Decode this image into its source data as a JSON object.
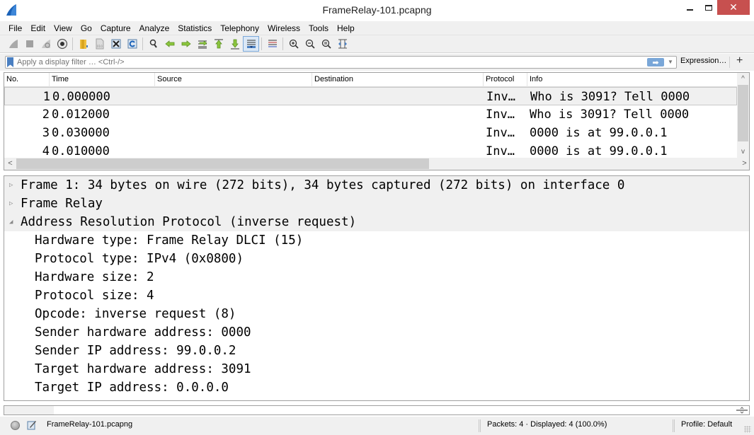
{
  "window": {
    "title": "FrameRelay-101.pcapng",
    "controls": {
      "minimize": "minimize",
      "maximize": "maximize",
      "close": "✕"
    }
  },
  "menu": {
    "items": [
      "File",
      "Edit",
      "View",
      "Go",
      "Capture",
      "Analyze",
      "Statistics",
      "Telephony",
      "Wireless",
      "Tools",
      "Help"
    ]
  },
  "toolbar": {
    "buttons": [
      {
        "icon": "shark-fin-start-icon",
        "label": "Start capturing packets"
      },
      {
        "icon": "stop-icon",
        "label": "Stop capturing packets"
      },
      {
        "icon": "restart-icon",
        "label": "Restart current capture"
      },
      {
        "icon": "capture-options-icon",
        "label": "Capture options"
      },
      {
        "icon": "open-file-icon",
        "label": "Open a capture file"
      },
      {
        "icon": "save-file-icon",
        "label": "Save this capture file"
      },
      {
        "icon": "close-file-icon",
        "label": "Close this capture file"
      },
      {
        "icon": "reload-icon",
        "label": "Reload this file"
      },
      {
        "icon": "find-icon",
        "label": "Find a packet"
      },
      {
        "icon": "go-back-icon",
        "label": "Go back in packet history"
      },
      {
        "icon": "go-forward-icon",
        "label": "Go forward in packet history"
      },
      {
        "icon": "go-to-packet-icon",
        "label": "Go to packet"
      },
      {
        "icon": "first-packet-icon",
        "label": "Go to the first packet"
      },
      {
        "icon": "last-packet-icon",
        "label": "Go to the last packet"
      },
      {
        "icon": "autoscroll-icon",
        "label": "Auto scroll in live capture",
        "active": true
      },
      {
        "icon": "colorize-icon",
        "label": "Colorize packet list"
      },
      {
        "icon": "zoom-in-icon",
        "label": "Zoom in"
      },
      {
        "icon": "zoom-out-icon",
        "label": "Zoom out"
      },
      {
        "icon": "zoom-normal-icon",
        "label": "Normal size"
      },
      {
        "icon": "resize-columns-icon",
        "label": "Resize columns"
      }
    ]
  },
  "filter": {
    "placeholder": "Apply a display filter … <Ctrl-/>",
    "value": "",
    "apply_arrow": "➡",
    "dropdown": "▼",
    "expression_label": "Expression…",
    "add_label": "+"
  },
  "packet_list": {
    "columns": [
      "No.",
      "Time",
      "Source",
      "Destination",
      "Protocol",
      "Info"
    ],
    "rows": [
      {
        "no": "1",
        "time": "0.000000",
        "source": "",
        "destination": "",
        "protocol": "Inv…",
        "info": "Who is 3091? Tell 0000",
        "selected": true
      },
      {
        "no": "2",
        "time": "0.012000",
        "source": "",
        "destination": "",
        "protocol": "Inv…",
        "info": "Who is 3091? Tell 0000"
      },
      {
        "no": "3",
        "time": "0.030000",
        "source": "",
        "destination": "",
        "protocol": "Inv…",
        "info": "0000 is at 99.0.0.1"
      },
      {
        "no": "4",
        "time": "0.010000",
        "source": "",
        "destination": "",
        "protocol": "Inv…",
        "info": "0000 is at 99.0.0.1"
      }
    ],
    "scroll": {
      "up": "^",
      "down": "v",
      "left": "<",
      "right": ">"
    }
  },
  "details": {
    "tree": [
      {
        "text": "Frame 1: 34 bytes on wire (272 bits), 34 bytes captured (272 bits) on interface 0",
        "expanded": false,
        "toggle": "▷"
      },
      {
        "text": "Frame Relay",
        "expanded": false,
        "toggle": "▷"
      },
      {
        "text": "Address Resolution Protocol (inverse request)",
        "expanded": true,
        "toggle": "◢",
        "children": [
          "Hardware type: Frame Relay DLCI (15)",
          "Protocol type: IPv4 (0x0800)",
          "Hardware size: 2",
          "Protocol size: 4",
          "Opcode: inverse request (8)",
          "Sender hardware address: 0000",
          "Sender IP address: 99.0.0.2",
          "Target hardware address: 3091",
          "Target IP address: 0.0.0.0"
        ]
      }
    ]
  },
  "status": {
    "file": "FrameRelay-101.pcapng",
    "packets": "Packets: 4 · Displayed: 4 (100.0%)",
    "profile": "Profile: Default"
  }
}
